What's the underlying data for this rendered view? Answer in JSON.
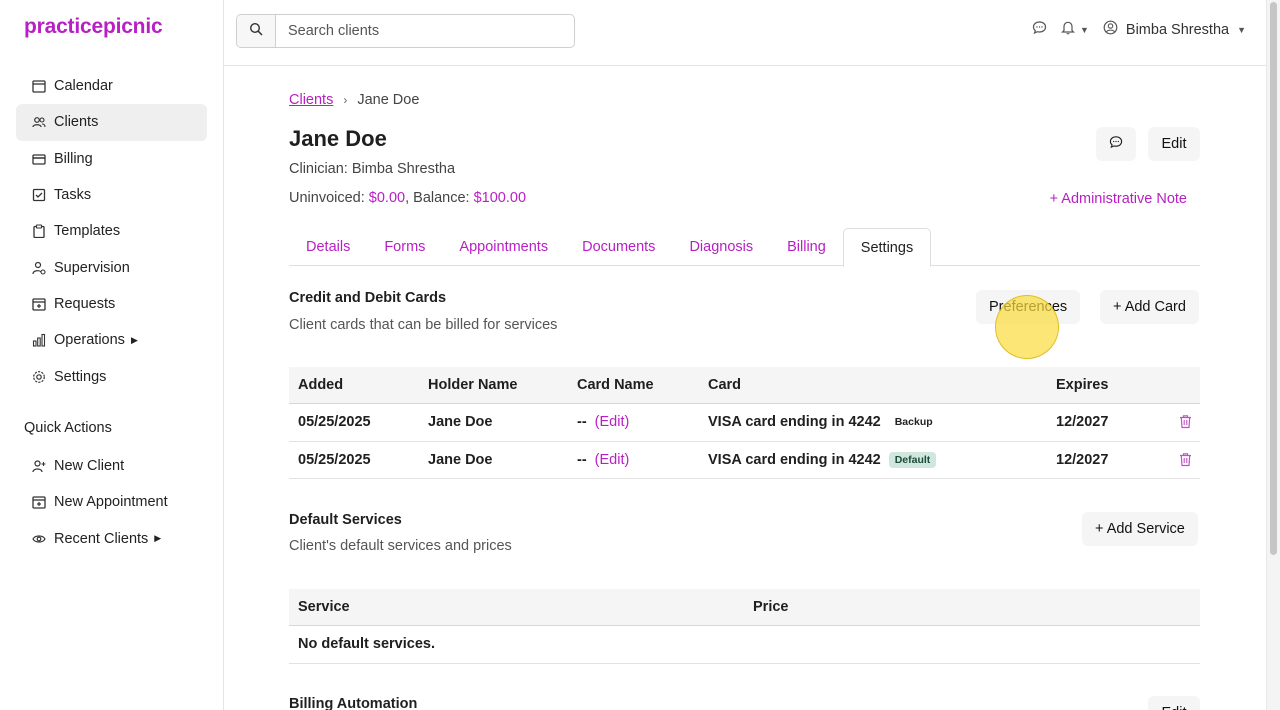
{
  "app": {
    "logo": "practicepicnic"
  },
  "sidebar": {
    "items": [
      {
        "label": "Calendar",
        "icon": "calendar-icon"
      },
      {
        "label": "Clients",
        "icon": "users-icon",
        "active": true
      },
      {
        "label": "Billing",
        "icon": "credit-card-icon"
      },
      {
        "label": "Tasks",
        "icon": "checkbox-icon"
      },
      {
        "label": "Templates",
        "icon": "clipboard-icon"
      },
      {
        "label": "Supervision",
        "icon": "user-supervision-icon"
      },
      {
        "label": "Requests",
        "icon": "calendar-plus-icon"
      },
      {
        "label": "Operations",
        "icon": "bar-chart-icon",
        "caret": true
      },
      {
        "label": "Settings",
        "icon": "gear-icon"
      }
    ],
    "quick_actions_title": "Quick Actions",
    "quick_actions": [
      {
        "label": "New Client",
        "icon": "user-plus-icon"
      },
      {
        "label": "New Appointment",
        "icon": "calendar-plus-icon"
      },
      {
        "label": "Recent Clients",
        "icon": "eye-icon",
        "caret": true
      }
    ]
  },
  "topbar": {
    "search_placeholder": "Search clients",
    "user_name": "Bimba Shrestha"
  },
  "breadcrumb": {
    "root": "Clients",
    "current": "Jane Doe"
  },
  "client": {
    "name": "Jane Doe",
    "clinician": "Clinician: Bimba Shrestha",
    "uninvoiced_label": "Uninvoiced: ",
    "uninvoiced": "$0.00",
    "balance_label": ", Balance: ",
    "balance": "$100.00"
  },
  "header_actions": {
    "edit": "Edit",
    "admin_note": "+ Administrative Note"
  },
  "tabs": [
    "Details",
    "Forms",
    "Appointments",
    "Documents",
    "Diagnosis",
    "Billing",
    "Settings"
  ],
  "active_tab": "Settings",
  "cards_section": {
    "title": "Credit and Debit Cards",
    "subtitle": "Client cards that can be billed for services",
    "preferences": "Preferences",
    "add_card": "+ Add Card",
    "columns": {
      "added": "Added",
      "holder": "Holder Name",
      "card_name": "Card Name",
      "card": "Card",
      "expires": "Expires"
    },
    "rows": [
      {
        "added": "05/25/2025",
        "holder": "Jane Doe",
        "card_name": "--",
        "edit": "(Edit)",
        "card": "VISA card ending in 4242",
        "badge": "Backup",
        "expires": "12/2027"
      },
      {
        "added": "05/25/2025",
        "holder": "Jane Doe",
        "card_name": "--",
        "edit": "(Edit)",
        "card": "VISA card ending in 4242",
        "badge": "Default",
        "expires": "12/2027"
      }
    ]
  },
  "services_section": {
    "title": "Default Services",
    "subtitle": "Client's default services and prices",
    "add_service": "+ Add Service",
    "columns": {
      "service": "Service",
      "price": "Price"
    },
    "empty": "No default services."
  },
  "automation_section": {
    "title": "Billing Automation",
    "edit": "Edit"
  },
  "colors": {
    "accent": "#b81fc4",
    "trash": "#c24fc9",
    "default_badge": "#cfe7dd"
  }
}
